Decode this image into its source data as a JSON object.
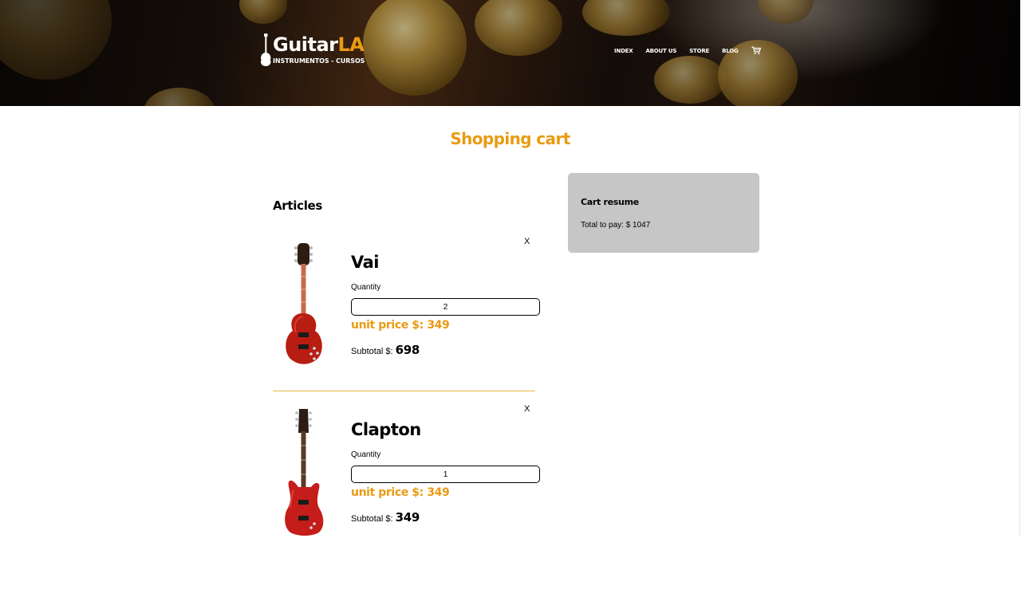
{
  "header": {
    "logo": {
      "name_prefix": "Guitar",
      "name_accent": "LA",
      "tagline": "INSTRUMENTOS - CURSOS"
    },
    "nav": [
      {
        "label": "INDEX"
      },
      {
        "label": "ABOUT US"
      },
      {
        "label": "STORE"
      },
      {
        "label": "BLOG"
      }
    ],
    "cart_icon": "shopping-cart-icon"
  },
  "page": {
    "title": "Shopping cart"
  },
  "articles": {
    "heading": "Articles",
    "items": [
      {
        "name": "Vai",
        "quantity_label": "Quantity",
        "quantity": "2",
        "unit_price_label": "unit price $:",
        "unit_price": "349",
        "subtotal_label": "Subtotal $:",
        "subtotal": "698",
        "remove_label": "X"
      },
      {
        "name": "Clapton",
        "quantity_label": "Quantity",
        "quantity": "1",
        "unit_price_label": "unit price $:",
        "unit_price": "349",
        "subtotal_label": "Subtotal $:",
        "subtotal": "349",
        "remove_label": "X"
      }
    ]
  },
  "cart_resume": {
    "title": "Cart resume",
    "total_label": "Total to pay: $",
    "total": "1047"
  },
  "colors": {
    "accent": "#e99b12",
    "resume_bg": "#c6c6c6",
    "divider": "#e9b64a"
  }
}
